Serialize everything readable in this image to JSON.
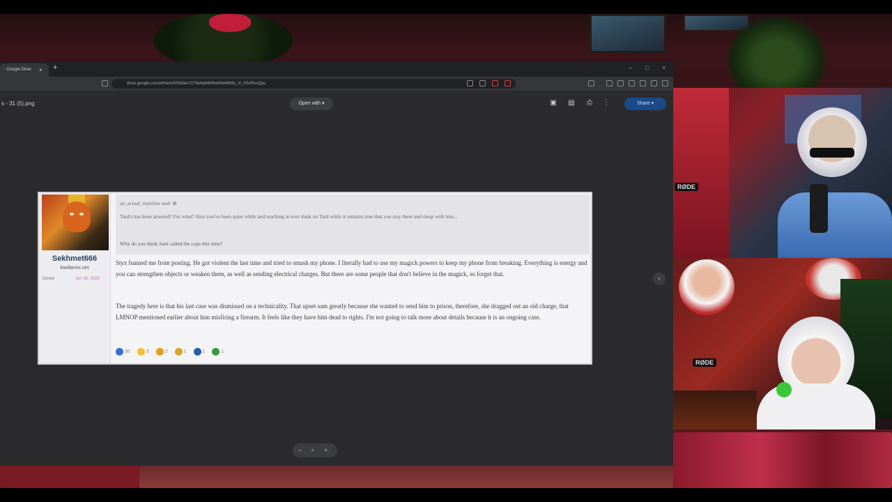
{
  "browser": {
    "tab_title": "- Google Drive",
    "tab_close": "×",
    "new_tab": "+",
    "url": "drive.google.com/drive/u/0/folders/1Tbuhpb6HhwGkb4iNfa_m_h5sRvuQpu",
    "window_controls": [
      "–",
      "□",
      "×"
    ]
  },
  "viewer": {
    "file_name": "s - 31 (5).png",
    "open_with_label": "Open with",
    "open_with_caret": "▾",
    "share_label": "Share",
    "share_caret": "▾",
    "zoom_controls": "–  ⌕  +",
    "next_arrow": "›"
  },
  "post": {
    "username": "Sekhmet666",
    "site": "kiwifarms.net",
    "joined_label": "Joined",
    "joined_date": "Jun 26, 2023",
    "quote_author": "an_actual_reptilian said: ⊕",
    "quote_text": "Tard's has been arrested? For what? Also you've been quiet while and reaching at ever dunk on Tard while it remains true that you stay there and sleep with him...",
    "quote_question": "Why do you think Sam called the cops this time?",
    "paragraph_1": "Styx banned me from posting. He got violent the last time and tried to smash my phone. I literally had to use my magick powers to keep my phone from breaking. Everything is energy and you can strengthen objects or weaken them, as well as sending electrical charges. But there are some people that don't believe in the magick, so forget that.",
    "paragraph_2": "The tragedy here is that his last case was dismissed on a technicality. That upset sam greatly because she wanted to send him to prison, therefore, she dragged out an old charge, that LMNOP mentioned earlier about him misfiring a firearm. It feels like they have him dead to rights. I'm not going to talk more about details because it is an ongoing case.",
    "reactions": [
      {
        "count": "30",
        "color": "#3b6fd4"
      },
      {
        "count": "3",
        "color": "#f2c230"
      },
      {
        "count": "2",
        "color": "#e0a020"
      },
      {
        "count": "1",
        "color": "#d8a628"
      },
      {
        "count": "1",
        "color": "#2a5aa8"
      },
      {
        "count": "1",
        "color": "#3a9a3a"
      }
    ]
  },
  "stream": {
    "mic_tag_1": "RØDE",
    "mic_tag_2": "RØDE"
  }
}
